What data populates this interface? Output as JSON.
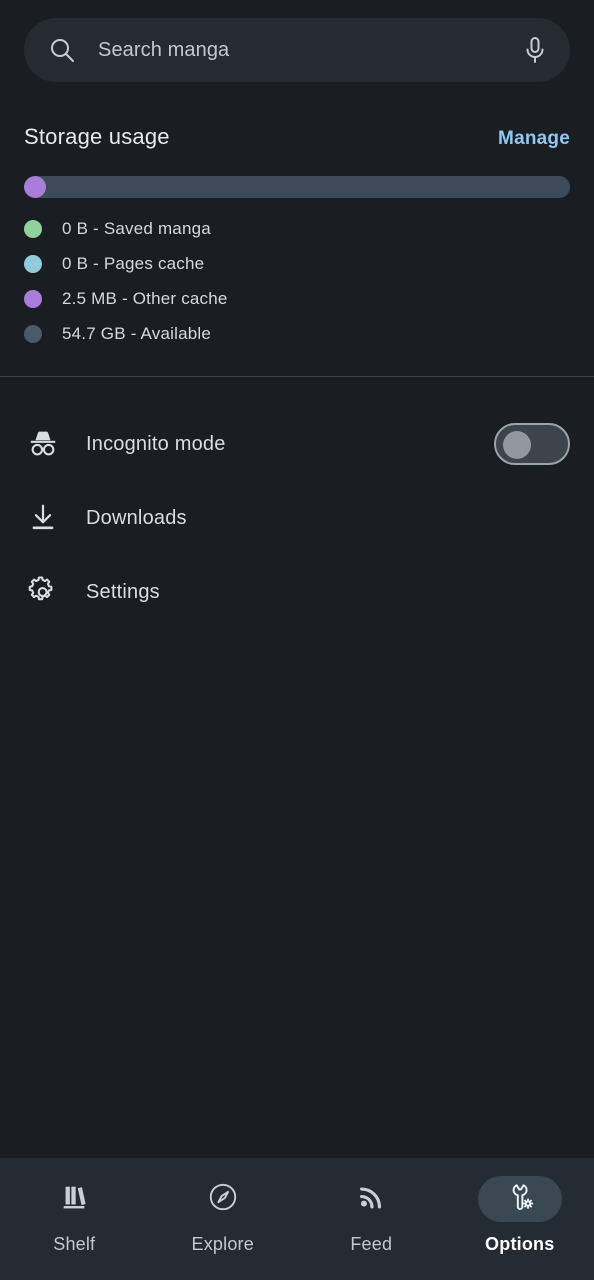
{
  "search": {
    "placeholder": "Search manga",
    "value": "",
    "search_icon": "search-icon",
    "mic_icon": "microphone-icon"
  },
  "storage": {
    "title": "Storage usage",
    "manage_label": "Manage",
    "bar_segments": [
      {
        "name": "Other cache",
        "color": "#a97ddb",
        "percent": 4.0
      },
      {
        "name": "Available",
        "color": "#3c4b57",
        "percent": 96.0
      }
    ],
    "legend": [
      {
        "color": "#8ed39e",
        "label": "0 B - Saved manga"
      },
      {
        "color": "#8fcddd",
        "label": "0 B - Pages cache"
      },
      {
        "color": "#a97ddb",
        "label": "2.5 MB - Other cache"
      },
      {
        "color": "#4a5a66",
        "label": "54.7 GB - Available"
      }
    ]
  },
  "menu": [
    {
      "label": "Incognito mode",
      "icon": "incognito-icon",
      "has_toggle": true,
      "toggle_on": false
    },
    {
      "label": "Downloads",
      "icon": "download-icon",
      "has_toggle": false
    },
    {
      "label": "Settings",
      "icon": "gear-icon",
      "has_toggle": false
    }
  ],
  "bottom_nav": {
    "items": [
      {
        "label": "Shelf",
        "icon": "books-icon",
        "active": false
      },
      {
        "label": "Explore",
        "icon": "compass-icon",
        "active": false
      },
      {
        "label": "Feed",
        "icon": "rss-icon",
        "active": false
      },
      {
        "label": "Options",
        "icon": "wrench-gear-icon",
        "active": true
      }
    ]
  },
  "colors": {
    "background": "#1a1d21",
    "surface": "#262b31",
    "nav_background": "#242b33",
    "accent_link": "#8fc9f2",
    "active_pill": "#3a4851"
  }
}
